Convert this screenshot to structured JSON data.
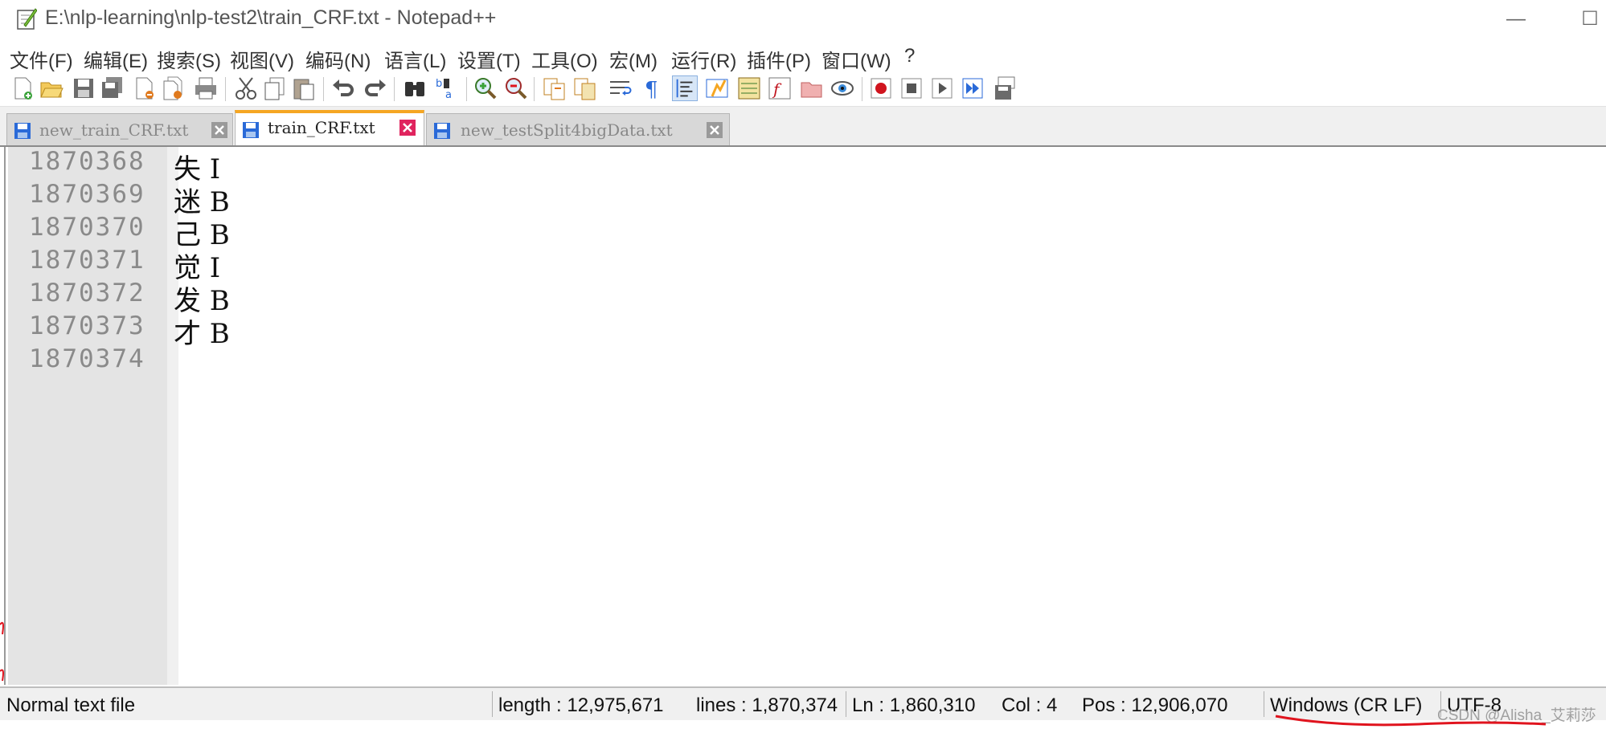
{
  "window": {
    "title": "E:\\nlp-learning\\nlp-test2\\train_CRF.txt - Notepad++",
    "minimize_glyph": "—",
    "maximize_glyph": "☐"
  },
  "menu": [
    "文件(F)",
    "编辑(E)",
    "搜索(S)",
    "视图(V)",
    "编码(N)",
    "语言(L)",
    "设置(T)",
    "工具(O)",
    "宏(M)",
    "运行(R)",
    "插件(P)",
    "窗口(W)",
    "?"
  ],
  "toolbar_icons": [
    "new-file-icon",
    "open-file-icon",
    "save-icon",
    "save-all-icon",
    "close-icon",
    "close-all-icon",
    "print-icon",
    "cut-icon",
    "copy-icon",
    "paste-icon",
    "undo-icon",
    "redo-icon",
    "find-icon",
    "replace-icon",
    "zoom-in-icon",
    "zoom-out-icon",
    "sync-vertical-icon",
    "sync-horizontal-icon",
    "word-wrap-icon",
    "show-all-chars-icon",
    "indent-guide-icon",
    "udl-icon",
    "doc-map-icon",
    "function-list-icon",
    "folder-as-workspace-icon",
    "monitor-icon",
    "record-macro-icon",
    "stop-record-icon",
    "play-macro-icon",
    "run-macro-multiple-icon",
    "save-macro-icon"
  ],
  "tabs": [
    {
      "label": "new_train_CRF.txt",
      "active": false
    },
    {
      "label": "train_CRF.txt",
      "active": true
    },
    {
      "label": "new_testSplit4bigData.txt",
      "active": false
    }
  ],
  "lines": [
    {
      "num": "1870368",
      "text": "失 I"
    },
    {
      "num": "1870369",
      "text": "迷 B"
    },
    {
      "num": "1870370",
      "text": "己 B"
    },
    {
      "num": "1870371",
      "text": "觉 I"
    },
    {
      "num": "1870372",
      "text": "发 B"
    },
    {
      "num": "1870373",
      "text": "才 B"
    },
    {
      "num": "1870374",
      "text": ""
    }
  ],
  "status": {
    "file_type": "Normal text file",
    "length": "length : 12,975,671",
    "lines": "lines : 1,870,374",
    "ln": "Ln : 1,860,310",
    "col": "Col : 4",
    "pos": "Pos : 12,906,070",
    "eol": "Windows (CR LF)",
    "encoding": "UTF-8"
  },
  "watermark": "CSDN @Alisha_艾莉莎",
  "colors": {
    "active_tab_accent": "#f5a623",
    "close_active": "#e0245e",
    "annotation_red": "#e0141e"
  }
}
